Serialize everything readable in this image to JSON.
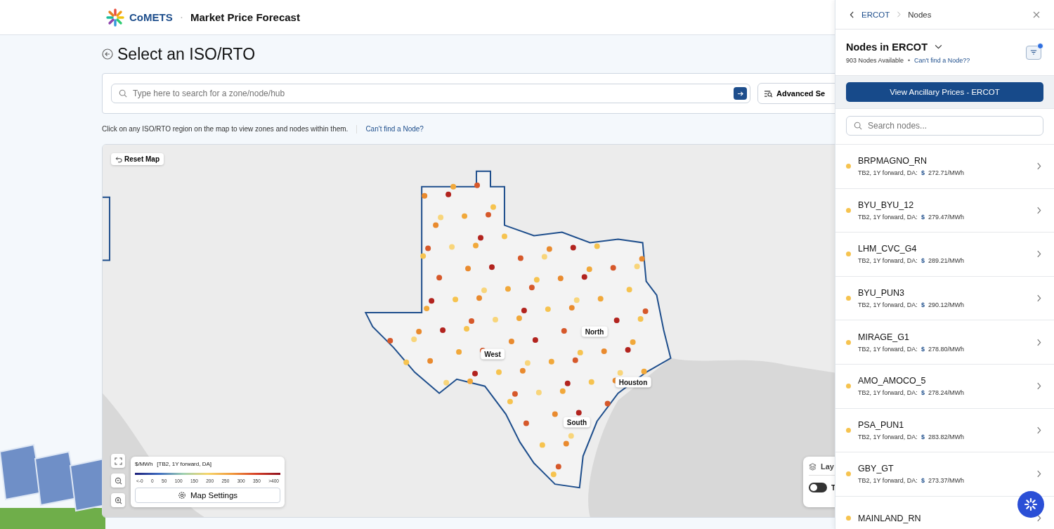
{
  "header": {
    "brand": "CoMETS",
    "separator": "·",
    "title": "Market Price Forecast"
  },
  "page": {
    "title": "Select an ISO/RTO"
  },
  "search": {
    "placeholder": "Type here to search for a zone/node/hub",
    "advanced_button": "Advanced Se"
  },
  "hint": {
    "text": "Click on any ISO/RTO region on the map to view zones and nodes within them.",
    "link": "Can't find a Node?"
  },
  "map": {
    "reset_button": "Reset Map",
    "zones": [
      {
        "label": "North"
      },
      {
        "label": "West"
      },
      {
        "label": "Houston"
      },
      {
        "label": "South"
      }
    ],
    "legend": {
      "unit": "$/MWh",
      "scenario": "[TB2, 1Y forward, DA]",
      "ticks": [
        "<-0",
        "0",
        "50",
        "100",
        "150",
        "200",
        "250",
        "300",
        "350",
        ">400"
      ]
    },
    "settings_button": "Map Settings",
    "layers": {
      "title": "Lay",
      "toggle_label": "T",
      "toggle_on": false
    }
  },
  "panel": {
    "breadcrumb": [
      {
        "label": "ERCOT",
        "kind": "link"
      },
      {
        "label": "Nodes",
        "kind": "current"
      }
    ],
    "title": "Nodes in ERCOT",
    "count": "903 Nodes Available",
    "separator": "•",
    "help_link": "Can't find a Node??",
    "filter_active": true,
    "ancillary_button": "View Ancillary Prices - ERCOT",
    "search_placeholder": "Search nodes...",
    "nodes": [
      {
        "name": "BRPMAGNO_RN",
        "detail": "TB2, 1Y forward, DA:",
        "currency": "$",
        "price": "272.71/MWh"
      },
      {
        "name": "BYU_BYU_12",
        "detail": "TB2, 1Y forward, DA:",
        "currency": "$",
        "price": "279.47/MWh"
      },
      {
        "name": "LHM_CVC_G4",
        "detail": "TB2, 1Y forward, DA:",
        "currency": "$",
        "price": "289.21/MWh"
      },
      {
        "name": "BYU_PUN3",
        "detail": "TB2, 1Y forward, DA:",
        "currency": "$",
        "price": "290.12/MWh"
      },
      {
        "name": "MIRAGE_G1",
        "detail": "TB2, 1Y forward, DA:",
        "currency": "$",
        "price": "278.80/MWh"
      },
      {
        "name": "AMO_AMOCO_5",
        "detail": "TB2, 1Y forward, DA:",
        "currency": "$",
        "price": "278.24/MWh"
      },
      {
        "name": "PSA_PUN1",
        "detail": "TB2, 1Y forward, DA:",
        "currency": "$",
        "price": "283.82/MWh"
      },
      {
        "name": "GBY_GT",
        "detail": "TB2, 1Y forward, DA:",
        "currency": "$",
        "price": "273.37/MWh"
      },
      {
        "name": "MAINLAND_RN"
      }
    ]
  }
}
